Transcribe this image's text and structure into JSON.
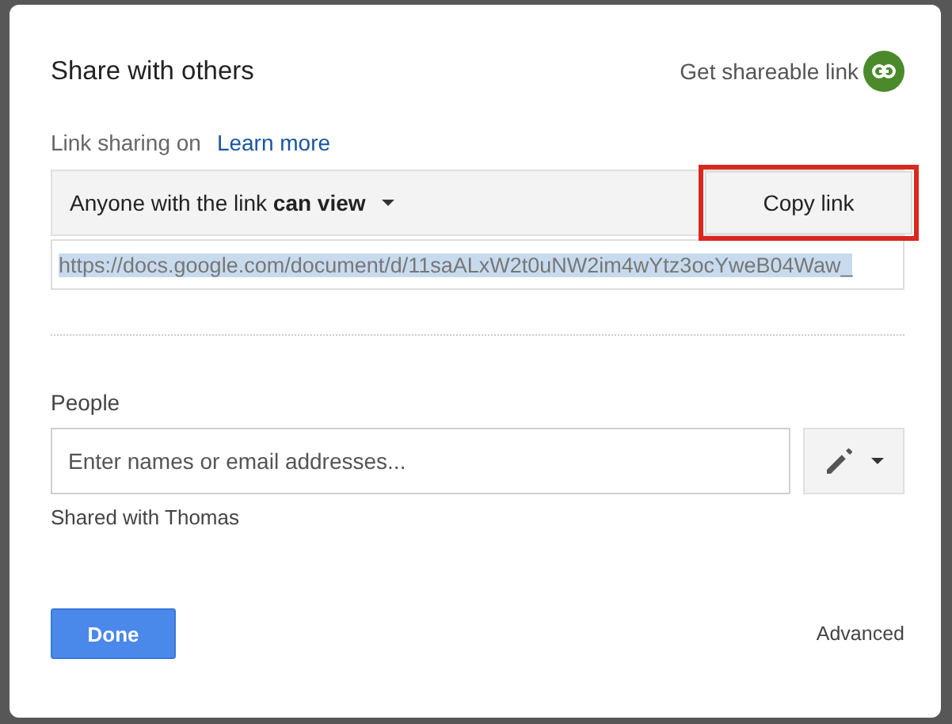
{
  "dialog": {
    "title": "Share with others",
    "shareable_link": {
      "label": "Get shareable link"
    }
  },
  "link_sharing": {
    "label": "Link sharing on",
    "learn_more": "Learn more",
    "access": {
      "prefix": "Anyone with the link ",
      "level": "can view"
    },
    "copy_button": {
      "label": "Copy link",
      "highlighted": true
    },
    "url": {
      "value": "https://docs.google.com/document/d/11saALxW2t0uNW2im4wYtz3ocYweB04Waw_",
      "selected": true
    }
  },
  "people": {
    "label": "People",
    "input": {
      "placeholder": "Enter names or email addresses..."
    },
    "shared_with": "Shared with Thomas"
  },
  "footer": {
    "done": "Done",
    "advanced": "Advanced"
  }
}
